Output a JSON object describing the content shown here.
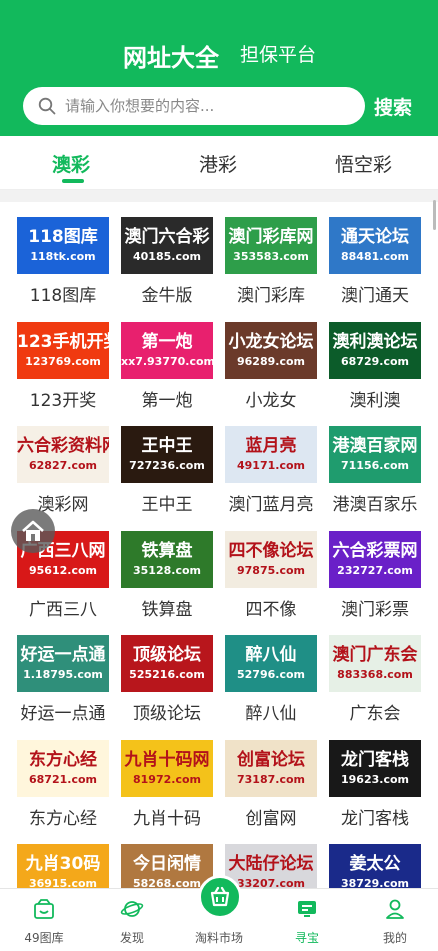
{
  "header": {
    "tabs": [
      "网址大全",
      "担保平台"
    ],
    "search_placeholder": "请输入你想要的内容...",
    "search_button": "搜索"
  },
  "categories": [
    "澳彩",
    "港彩",
    "悟空彩"
  ],
  "colors": {
    "accent": "#12b95c"
  },
  "sites": [
    {
      "label": "118图库",
      "t1": "118图库",
      "t2": "118tk.com",
      "bg": "#1b63d8"
    },
    {
      "label": "金牛版",
      "t1": "澳门六合彩",
      "t2": "40185.com",
      "bg": "#2a2a2a"
    },
    {
      "label": "澳门彩库",
      "t1": "澳门彩库网",
      "t2": "353583.com",
      "bg": "#2e9e4a"
    },
    {
      "label": "澳门通天",
      "t1": "通天论坛",
      "t2": "88481.com",
      "bg": "#2f78c8"
    },
    {
      "label": "123开奖",
      "t1": "123手机开奖",
      "t2": "123769.com",
      "bg": "#f03a10"
    },
    {
      "label": "第一炮",
      "t1": "第一炮",
      "t2": "xx7.93770.com",
      "bg": "#e8206e"
    },
    {
      "label": "小龙女",
      "t1": "小龙女论坛",
      "t2": "96289.com",
      "bg": "#6b3a2a"
    },
    {
      "label": "澳利澳",
      "t1": "澳利澳论坛",
      "t2": "68729.com",
      "bg": "#0c5c2a"
    },
    {
      "label": "澳彩网",
      "t1": "六合彩资料网",
      "t2": "62827.com",
      "bg": "#f6f0e6"
    },
    {
      "label": "王中王",
      "t1": "王中王",
      "t2": "727236.com",
      "bg": "#2a1a10"
    },
    {
      "label": "澳门蓝月亮",
      "t1": "蓝月亮",
      "t2": "49171.com",
      "bg": "#dde7f2"
    },
    {
      "label": "港澳百家乐",
      "t1": "港澳百家网",
      "t2": "71156.com",
      "bg": "#1f9c6e"
    },
    {
      "label": "广西三八",
      "t1": "广西三八网",
      "t2": "95612.com",
      "bg": "#d81818"
    },
    {
      "label": "铁算盘",
      "t1": "铁算盘",
      "t2": "35128.com",
      "bg": "#2e7a2a"
    },
    {
      "label": "四不像",
      "t1": "四不像论坛",
      "t2": "97875.com",
      "bg": "#f2ece0"
    },
    {
      "label": "澳门彩票",
      "t1": "六合彩票网",
      "t2": "232727.com",
      "bg": "#6a20c8"
    },
    {
      "label": "好运一点通",
      "t1": "好运一点通",
      "t2": "1.18795.com",
      "bg": "#2f8f7a"
    },
    {
      "label": "顶级论坛",
      "t1": "顶级论坛",
      "t2": "525216.com",
      "bg": "#b8161c"
    },
    {
      "label": "醉八仙",
      "t1": "醉八仙",
      "t2": "52796.com",
      "bg": "#1f8f86"
    },
    {
      "label": "广东会",
      "t1": "澳门广东会",
      "t2": "883368.com",
      "bg": "#e6f0e6"
    },
    {
      "label": "东方心经",
      "t1": "东方心经",
      "t2": "68721.com",
      "bg": "#fff6dc"
    },
    {
      "label": "九肖十码",
      "t1": "九肖十码网",
      "t2": "81972.com",
      "bg": "#f4c21a"
    },
    {
      "label": "创富网",
      "t1": "创富论坛",
      "t2": "73187.com",
      "bg": "#f0e2c8"
    },
    {
      "label": "龙门客栈",
      "t1": "龙门客栈",
      "t2": "19623.com",
      "bg": "#181818"
    },
    {
      "label": "",
      "t1": "九肖30码",
      "t2": "36915.com",
      "bg": "#f4a81a"
    },
    {
      "label": "",
      "t1": "今日闲情",
      "t2": "58268.com",
      "bg": "#b07840"
    },
    {
      "label": "",
      "t1": "大陆仔论坛",
      "t2": "33207.com",
      "bg": "#d8d8dc"
    },
    {
      "label": "",
      "t1": "姜太公",
      "t2": "38729.com",
      "bg": "#1a2a8a"
    }
  ],
  "tabbar": [
    {
      "label": "49图库",
      "icon": "gallery-icon"
    },
    {
      "label": "发现",
      "icon": "planet-icon"
    },
    {
      "label": "淘料市场",
      "icon": "basket-icon"
    },
    {
      "label": "寻宝",
      "icon": "monitor-icon"
    },
    {
      "label": "我的",
      "icon": "person-icon"
    }
  ]
}
